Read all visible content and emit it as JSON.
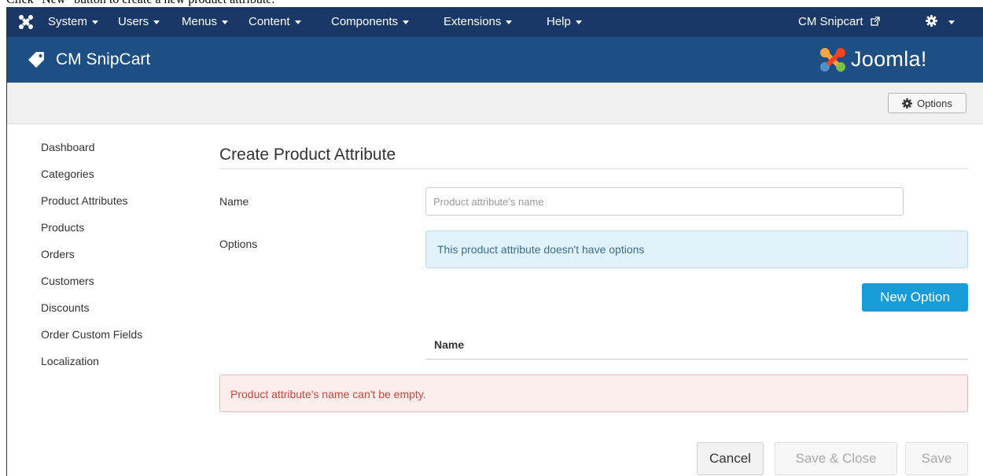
{
  "caption": "Click \"New\" button to create a new product attribute.",
  "topbar": {
    "menus": [
      {
        "label": "System"
      },
      {
        "label": "Users"
      },
      {
        "label": "Menus"
      },
      {
        "label": "Content"
      },
      {
        "label": "Components"
      },
      {
        "label": "Extensions"
      },
      {
        "label": "Help"
      }
    ],
    "site_link": "CM Snipcart"
  },
  "header": {
    "title": "CM SnipCart",
    "brand": "Joomla!"
  },
  "toolbar": {
    "options_label": "Options"
  },
  "sidebar": {
    "items": [
      {
        "label": "Dashboard"
      },
      {
        "label": "Categories"
      },
      {
        "label": "Product Attributes"
      },
      {
        "label": "Products"
      },
      {
        "label": "Orders"
      },
      {
        "label": "Customers"
      },
      {
        "label": "Discounts"
      },
      {
        "label": "Order Custom Fields"
      },
      {
        "label": "Localization"
      }
    ]
  },
  "form": {
    "page_title": "Create Product Attribute",
    "name_label": "Name",
    "name_placeholder": "Product attribute's name",
    "name_value": "",
    "options_label": "Options",
    "options_info": "This product attribute doesn't have options",
    "new_option_label": "New Option",
    "table_header_name": "Name",
    "error_message": "Product attribute's name can't be empty."
  },
  "footer": {
    "cancel_label": "Cancel",
    "save_close_label": "Save & Close",
    "save_label": "Save"
  },
  "colors": {
    "topbar": "#1a3867",
    "header": "#1d4e84",
    "primary_button": "#189cd8",
    "error_text": "#c9463a",
    "info_text": "#3a6f8f"
  }
}
